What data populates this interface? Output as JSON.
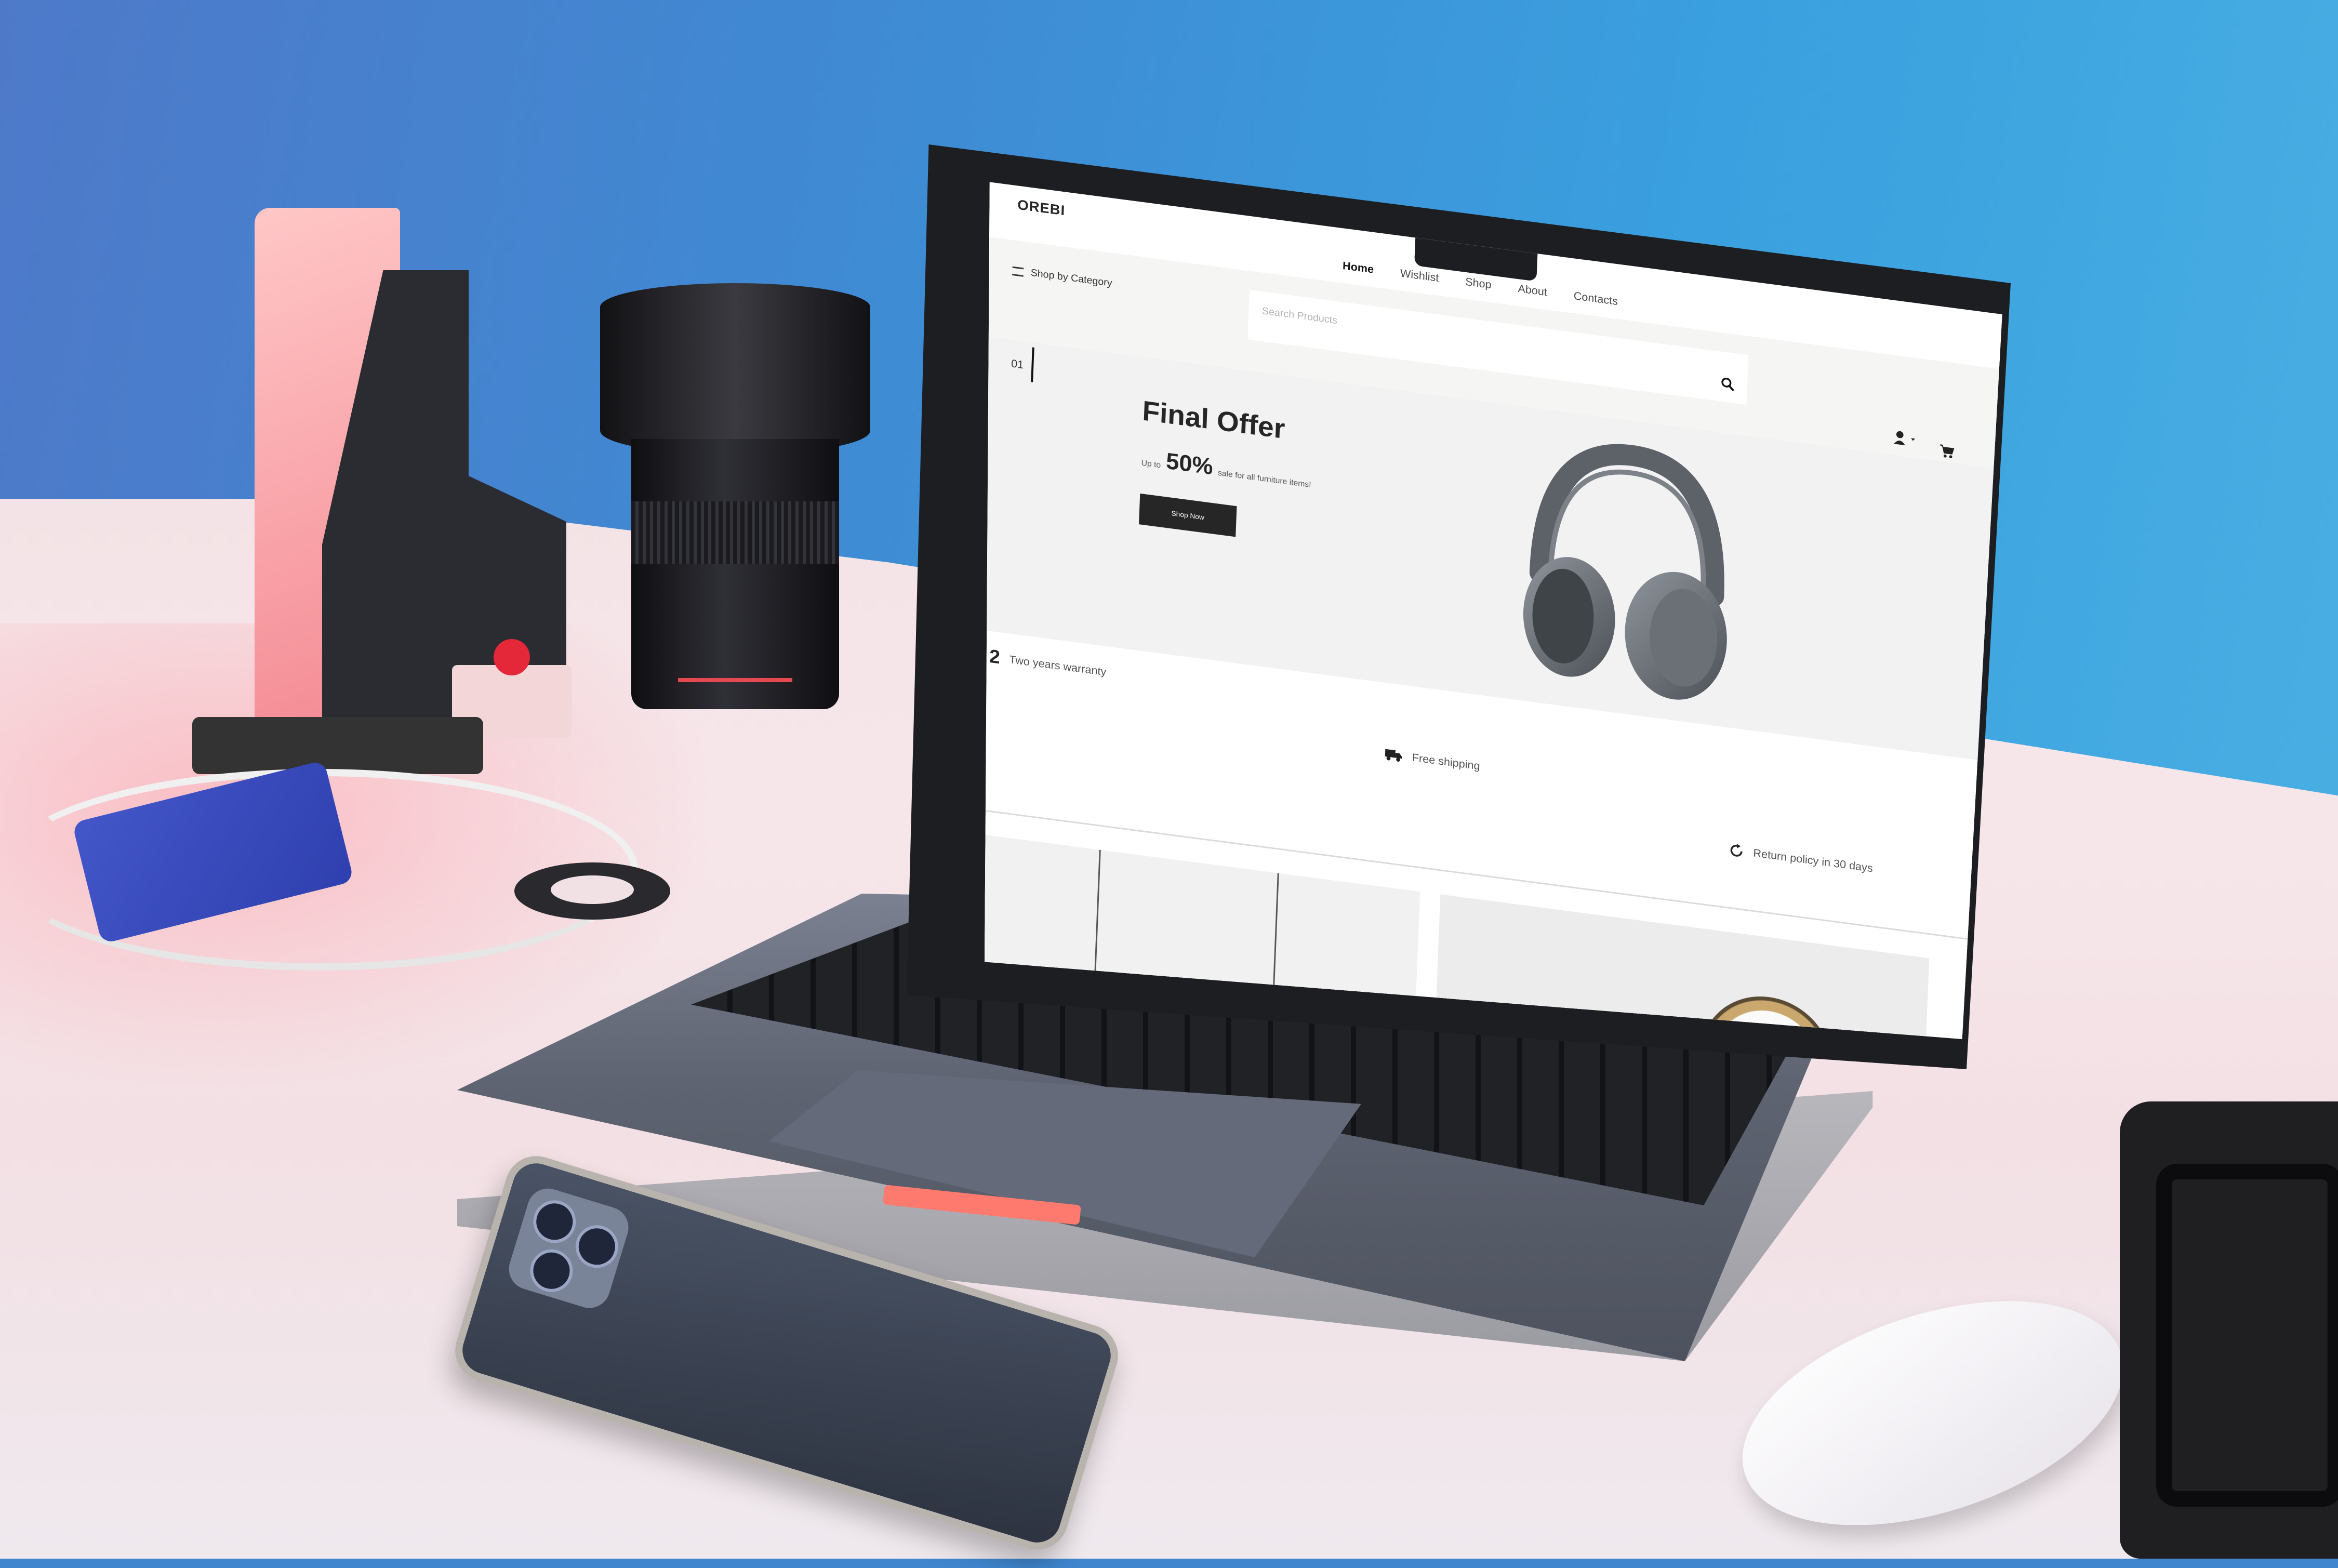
{
  "site": {
    "logo": "OREBI"
  },
  "nav": {
    "items": [
      "Home",
      "Wishlist",
      "Shop",
      "About",
      "Contacts"
    ],
    "active": "Home"
  },
  "toolbar": {
    "category_label": "Shop by Category",
    "search_placeholder": "Search Products"
  },
  "hero": {
    "slide_number": "01",
    "title": "Final Offer",
    "subtitle_prefix": "Up to",
    "discount": "50%",
    "subtitle_suffix": "sale for all furniture items!",
    "button_label": "Shop Now"
  },
  "features": {
    "warranty_number": "2",
    "warranty_label": "Two years warranty",
    "shipping_label": "Free shipping",
    "return_label": "Return policy in 30 days"
  },
  "icons": {
    "menu": "hamburger-icon",
    "search": "search-icon",
    "user": "user-icon",
    "cart": "cart-icon",
    "truck": "truck-icon",
    "refresh": "refresh-icon"
  },
  "colors": {
    "accent": "#262626",
    "page_bg": "#ffffff",
    "bar_bg": "#f5f5f3",
    "hero_bg": "#f2f2f2"
  }
}
